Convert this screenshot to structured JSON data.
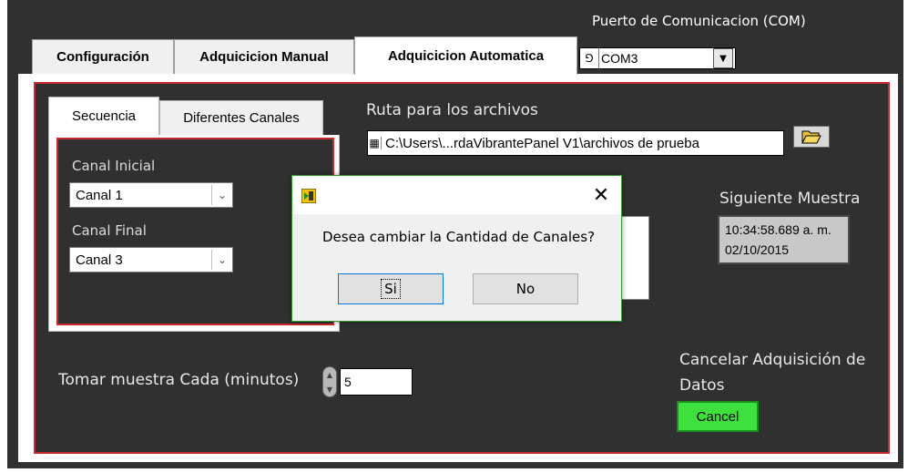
{
  "com": {
    "label": "Puerto de Comunicacion (COM)",
    "io_prefix": "I/O",
    "value": "COM3"
  },
  "tabs": [
    {
      "label": "Configuración"
    },
    {
      "label": "Adquicicion Manual"
    },
    {
      "label": "Adquicicion Automatica"
    }
  ],
  "inner_tabs": [
    {
      "label": "Secuencia"
    },
    {
      "label": "Diferentes Canales"
    }
  ],
  "canal_inicial": {
    "label": "Canal Inicial",
    "value": "Canal 1"
  },
  "canal_final": {
    "label": "Canal Final",
    "value": "Canal 3"
  },
  "ruta": {
    "label": "Ruta para los archivos",
    "value": "C:\\Users\\...rdaVibrantePanel V1\\archivos de prueba"
  },
  "siguiente": {
    "label": "Siguiente Muestra",
    "line1": "10:34:58.689 a. m.",
    "line2": "02/10/2015"
  },
  "tomar": {
    "label": "Tomar muestra Cada (minutos)",
    "value": "5"
  },
  "cancelar": {
    "label": "Cancelar Adquisición de Datos",
    "button": "Cancel"
  },
  "dialog": {
    "message": "Desea cambiar la Cantidad de Canales?",
    "yes": "Si",
    "no": "No",
    "close": "✕"
  },
  "colors": {
    "panel": "#303030",
    "frame": "#c8282e",
    "cancel": "#3ee03e"
  }
}
